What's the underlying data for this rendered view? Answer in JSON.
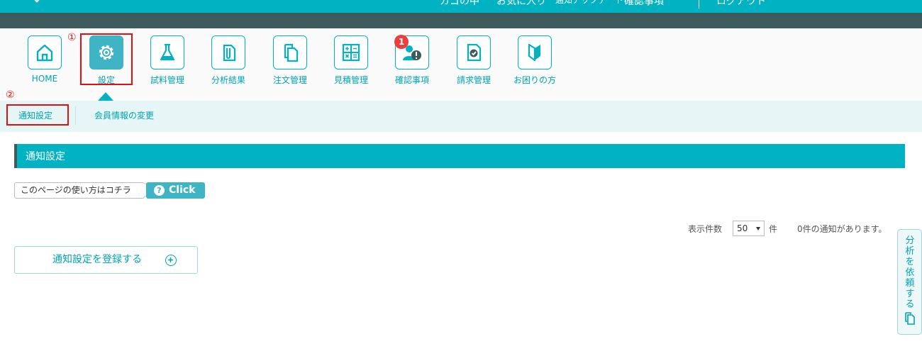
{
  "topbar": {
    "cart": "カゴの中",
    "favorites": "お気に入り",
    "notice_update": "通知アップデート",
    "confirm": "確認事項",
    "logout": "ログアウト"
  },
  "nav": {
    "items": [
      {
        "label": "HOME",
        "icon": "home-icon"
      },
      {
        "label": "設定",
        "icon": "gear-icon"
      },
      {
        "label": "試料管理",
        "icon": "flask-icon"
      },
      {
        "label": "分析結果",
        "icon": "test-tube-doc-icon"
      },
      {
        "label": "注文管理",
        "icon": "copy-docs-icon"
      },
      {
        "label": "見積管理",
        "icon": "calculator-icon"
      },
      {
        "label": "確認事項",
        "icon": "user-alert-icon"
      },
      {
        "label": "請求管理",
        "icon": "invoice-check-icon"
      },
      {
        "label": "お困りの方",
        "icon": "beginner-mark-icon"
      }
    ],
    "badge": "1",
    "active_index": 1
  },
  "annotations": {
    "marker1": "①",
    "marker2": "②"
  },
  "subnav": {
    "items": [
      {
        "label": "通知設定"
      },
      {
        "label": "会員情報の変更"
      }
    ]
  },
  "section": {
    "title": "通知設定"
  },
  "howto": {
    "text": "このページの使い方はコチラ",
    "button": "Click",
    "q_icon": "?"
  },
  "listing": {
    "count_label": "表示件数",
    "per_page": "50",
    "unit": "件",
    "notice_count": "0件の通知があります。"
  },
  "register_button": "通知設定を登録する",
  "side_tab": {
    "label": "分析を依頼する",
    "icon": "copy-docs-icon"
  },
  "colors": {
    "accent": "#00b2c2",
    "dark_bar": "#3e5b5d",
    "alert_red": "#ee3d3d",
    "annotation_red": "#e01010"
  }
}
